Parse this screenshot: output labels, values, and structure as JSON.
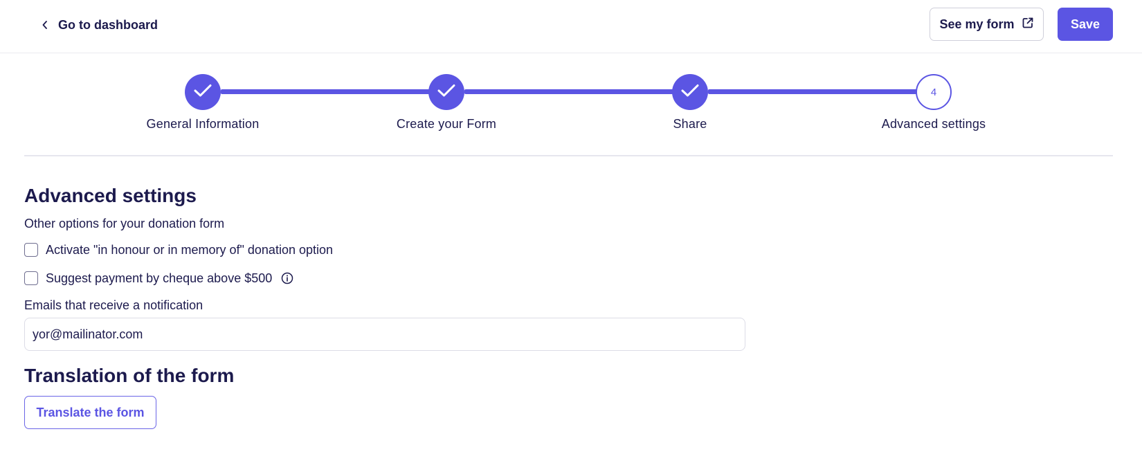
{
  "header": {
    "back_label": "Go to dashboard",
    "see_form_label": "See my form",
    "save_label": "Save"
  },
  "stepper": {
    "steps": [
      {
        "label": "General Information",
        "state": "completed"
      },
      {
        "label": "Create your Form",
        "state": "completed"
      },
      {
        "label": "Share",
        "state": "completed"
      },
      {
        "label": "Advanced settings",
        "state": "current",
        "number": "4"
      }
    ]
  },
  "advanced": {
    "title": "Advanced settings",
    "subtitle": "Other options for your donation form",
    "options": [
      {
        "label": "Activate \"in honour or in memory of\" donation option",
        "checked": false
      },
      {
        "label": "Suggest payment by cheque above $500",
        "checked": false,
        "has_info_icon": true
      }
    ],
    "emails_label": "Emails that receive a notification",
    "emails_value": "yor@mailinator.com"
  },
  "translation": {
    "title": "Translation of the form",
    "button_label": "Translate the form"
  },
  "colors": {
    "accent": "#5b55e3",
    "text": "#1c1a4d",
    "border": "#dcdce6"
  },
  "icons": {
    "back": "chevron-left-icon",
    "see_form": "external-link-icon",
    "step_done": "check-icon",
    "info": "info-icon"
  }
}
